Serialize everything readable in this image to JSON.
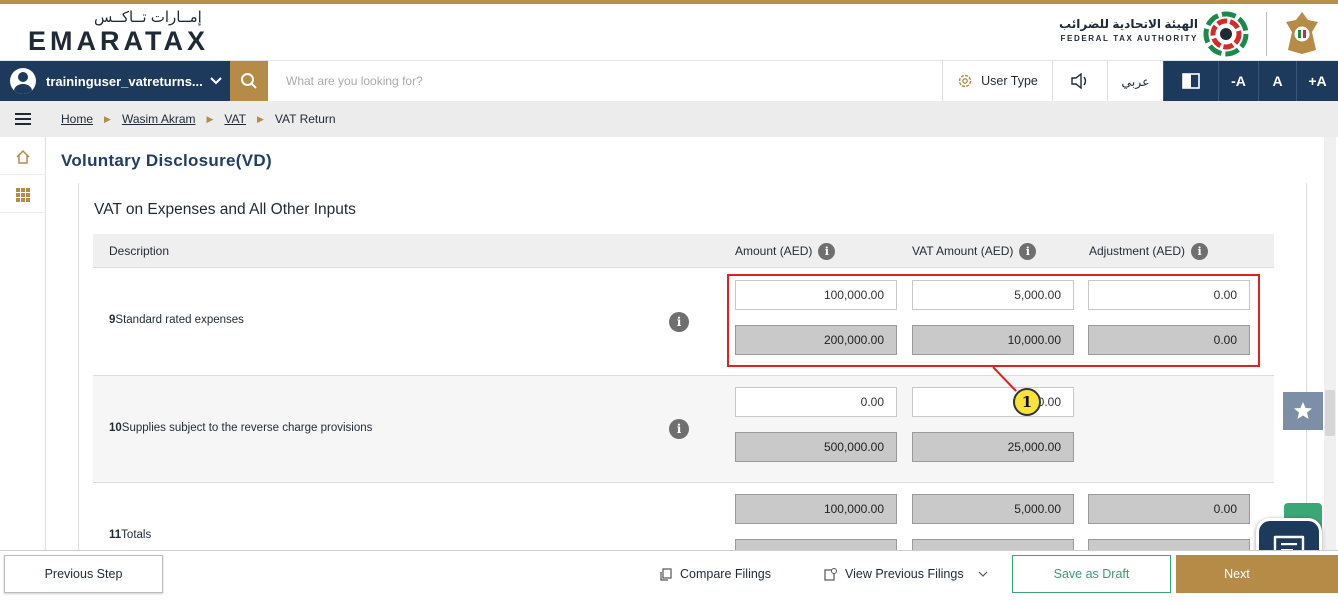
{
  "header": {
    "logo_arabic": "إمــارات تــاكــس",
    "logo_text": "EMARATAX",
    "authority_arabic": "الهيئة الاتحادية للضرائب",
    "authority_english": "FEDERAL TAX AUTHORITY"
  },
  "toolbar": {
    "username": "traininguser_vatreturns...",
    "search_placeholder": "What are you looking for?",
    "user_type_label": "User Type",
    "arabic_label": "عربي",
    "font_decrease": "-A",
    "font_reset": "A",
    "font_increase": "+A"
  },
  "breadcrumb": {
    "items": [
      "Home",
      "Wasim Akram",
      "VAT"
    ],
    "current": "VAT Return"
  },
  "page": {
    "title": "Voluntary Disclosure(VD)",
    "section_title": "VAT on Expenses and All Other Inputs"
  },
  "table": {
    "headers": {
      "description": "Description",
      "amount": "Amount (AED)",
      "vat_amount": "VAT Amount (AED)",
      "adjustment": "Adjustment (AED)"
    },
    "rows": [
      {
        "number": "9",
        "label": "Standard rated expenses",
        "amount_input": "100,000.00",
        "vat_input": "5,000.00",
        "adjustment_input": "0.00",
        "amount_original": "200,000.00",
        "vat_original": "10,000.00",
        "adjustment_original": "0.00"
      },
      {
        "number": "10",
        "label": "Supplies subject to the reverse charge provisions",
        "amount_input": "0.00",
        "vat_input": "0.00",
        "amount_original": "500,000.00",
        "vat_original": "25,000.00"
      },
      {
        "number": "11",
        "label": "Totals",
        "amount_total": "100,000.00",
        "vat_total": "5,000.00",
        "adjustment_total": "0.00"
      }
    ]
  },
  "annotation": {
    "callout_number": "1",
    "highlight_color": "#e02020"
  },
  "footer": {
    "previous_step": "Previous Step",
    "compare_filings": "Compare Filings",
    "view_previous_filings": "View Previous Filings",
    "save_as_draft": "Save as Draft",
    "next": "Next"
  },
  "colors": {
    "brand_navy": "#1d3a5c",
    "brand_gold": "#b58b47",
    "success_green": "#3aa876"
  }
}
